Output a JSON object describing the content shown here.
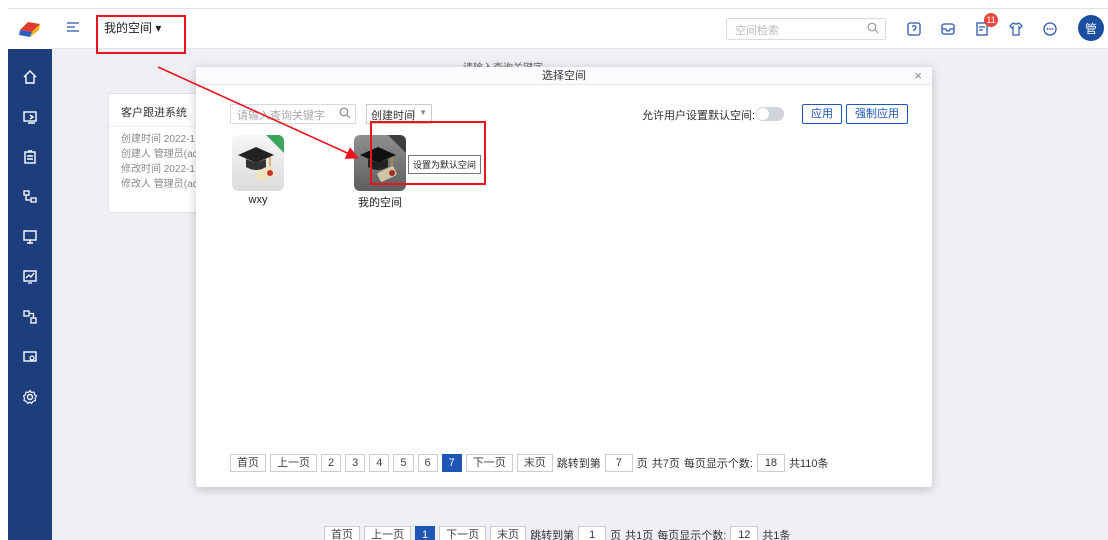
{
  "header": {
    "space_label": "我的空间 ▾",
    "search_placeholder": "空间检索",
    "badge_count": "11",
    "avatar": "管"
  },
  "sidebar": {
    "items": [
      "home-icon",
      "import-icon",
      "clipboard-icon",
      "org-icon",
      "monitor-icon",
      "chart-icon",
      "flow-icon",
      "screen-icon",
      "settings-icon"
    ]
  },
  "background": {
    "card_title": "客户跟进系统",
    "card_rows": [
      "创建时间 2022-1",
      "创建人 管理员(ac",
      "修改时间 2022-1",
      "修改人 管理员(ac"
    ],
    "search_hint": "请输入查询关键字",
    "pager": {
      "first": "首页",
      "prev": "上一页",
      "current": "1",
      "next": "下一页",
      "last": "末页",
      "jump": "跳转到第",
      "page_value": "1",
      "page_unit": "页",
      "total_pages": "共1页",
      "per_page_label": "每页显示个数:",
      "per_page": "12",
      "total": "共1条"
    }
  },
  "modal": {
    "title": "选择空间",
    "close": "×",
    "search_placeholder": "请输入查询关键字",
    "sort": "创建时间",
    "allow_label": "允许用户设置默认空间:",
    "apply": "应用",
    "force_apply": "强制应用",
    "spaces": [
      {
        "name": "wxy"
      },
      {
        "name": "我的空间"
      }
    ],
    "tooltip": "设置为默认空间",
    "pager": {
      "first": "首页",
      "prev": "上一页",
      "pages": [
        "2",
        "3",
        "4",
        "5",
        "6"
      ],
      "current": "7",
      "next": "下一页",
      "last": "末页",
      "jump": "跳转到第",
      "page_value": "7",
      "page_unit": "页",
      "total_pages": "共7页",
      "per_page_label": "每页显示个数:",
      "per_page": "18",
      "total": "共110条"
    }
  }
}
